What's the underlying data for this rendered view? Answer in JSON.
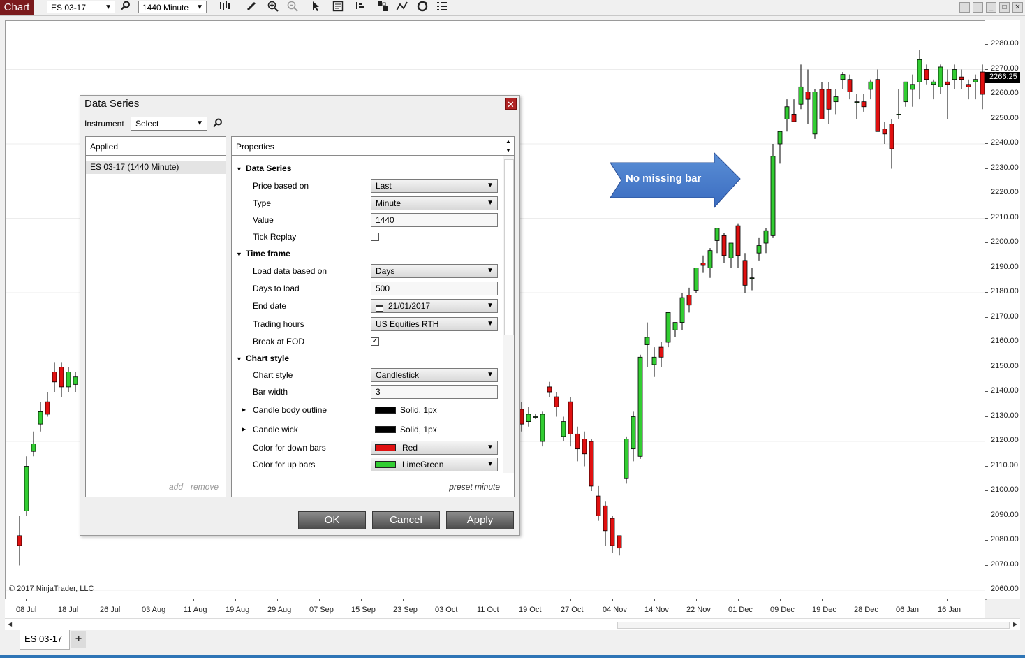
{
  "toolbar": {
    "chart_tab": "Chart",
    "instrument": "ES 03-17",
    "interval": "1440 Minute",
    "icons": [
      "search-icon",
      "bars-icon",
      "pencil-icon",
      "zoom-in-icon",
      "zoom-out-icon",
      "pointer-icon",
      "data-box-icon",
      "indicators-icon",
      "strategies-icon",
      "drawing-tools-icon",
      "refresh-icon",
      "properties-list-icon"
    ]
  },
  "chart": {
    "copyright": "© 2017 NinjaTrader, LLC",
    "price_ticks": [
      "2280.00",
      "2270.00",
      "2260.00",
      "2250.00",
      "2240.00",
      "2230.00",
      "2220.00",
      "2210.00",
      "2200.00",
      "2190.00",
      "2180.00",
      "2170.00",
      "2160.00",
      "2150.00",
      "2140.00",
      "2130.00",
      "2120.00",
      "2110.00",
      "2100.00",
      "2090.00",
      "2080.00",
      "2070.00",
      "2060.00"
    ],
    "last_price": "2266.25",
    "date_ticks": [
      "08 Jul",
      "18 Jul",
      "26 Jul",
      "03 Aug",
      "11 Aug",
      "19 Aug",
      "29 Aug",
      "07 Sep",
      "15 Sep",
      "23 Sep",
      "03 Oct",
      "11 Oct",
      "19 Oct",
      "27 Oct",
      "04 Nov",
      "14 Nov",
      "22 Nov",
      "01 Dec",
      "09 Dec",
      "19 Dec",
      "28 Dec",
      "06 Jan",
      "16 Jan"
    ],
    "annotation": "No missing bar",
    "down_color": "#e01010",
    "up_color": "#32cd32"
  },
  "chart_data": {
    "type": "candlestick",
    "ylim": [
      2060,
      2285
    ],
    "candles_left": [
      {
        "o": 2082,
        "h": 2090,
        "l": 2070,
        "c": 2078
      },
      {
        "o": 2092,
        "h": 2114,
        "l": 2090,
        "c": 2110
      },
      {
        "o": 2116,
        "h": 2124,
        "l": 2114,
        "c": 2119
      },
      {
        "o": 2127,
        "h": 2136,
        "l": 2124,
        "c": 2132
      },
      {
        "o": 2136,
        "h": 2140,
        "l": 2130,
        "c": 2131
      },
      {
        "o": 2148,
        "h": 2152,
        "l": 2140,
        "c": 2144
      },
      {
        "o": 2150,
        "h": 2152,
        "l": 2138,
        "c": 2142
      },
      {
        "o": 2142,
        "h": 2150,
        "l": 2140,
        "c": 2148
      },
      {
        "o": 2143,
        "h": 2148,
        "l": 2140,
        "c": 2146
      }
    ],
    "candles_right": [
      {
        "o": 2133,
        "h": 2136,
        "l": 2124,
        "c": 2127
      },
      {
        "o": 2128,
        "h": 2134,
        "l": 2126,
        "c": 2131
      },
      {
        "o": 2130,
        "h": 2131,
        "l": 2129,
        "c": 2130
      },
      {
        "o": 2120,
        "h": 2132,
        "l": 2118,
        "c": 2131
      },
      {
        "o": 2142,
        "h": 2144,
        "l": 2138,
        "c": 2140
      },
      {
        "o": 2138,
        "h": 2140,
        "l": 2130,
        "c": 2134
      },
      {
        "o": 2122,
        "h": 2130,
        "l": 2120,
        "c": 2128
      },
      {
        "o": 2136,
        "h": 2138,
        "l": 2118,
        "c": 2123
      },
      {
        "o": 2123,
        "h": 2126,
        "l": 2112,
        "c": 2117
      },
      {
        "o": 2121,
        "h": 2124,
        "l": 2110,
        "c": 2115
      },
      {
        "o": 2120,
        "h": 2121,
        "l": 2100,
        "c": 2102
      },
      {
        "o": 2098,
        "h": 2102,
        "l": 2088,
        "c": 2090
      },
      {
        "o": 2094,
        "h": 2096,
        "l": 2078,
        "c": 2084
      },
      {
        "o": 2089,
        "h": 2090,
        "l": 2075,
        "c": 2078
      },
      {
        "o": 2082,
        "h": 2082,
        "l": 2074,
        "c": 2077
      },
      {
        "o": 2105,
        "h": 2122,
        "l": 2103,
        "c": 2121
      },
      {
        "o": 2117,
        "h": 2132,
        "l": 2112,
        "c": 2130
      },
      {
        "o": 2114,
        "h": 2155,
        "l": 2113,
        "c": 2154
      },
      {
        "o": 2159,
        "h": 2168,
        "l": 2150,
        "c": 2162
      },
      {
        "o": 2151,
        "h": 2158,
        "l": 2146,
        "c": 2154
      },
      {
        "o": 2158,
        "h": 2160,
        "l": 2150,
        "c": 2154
      },
      {
        "o": 2160,
        "h": 2172,
        "l": 2158,
        "c": 2172
      },
      {
        "o": 2165,
        "h": 2168,
        "l": 2162,
        "c": 2168
      },
      {
        "o": 2168,
        "h": 2180,
        "l": 2165,
        "c": 2178
      },
      {
        "o": 2179,
        "h": 2182,
        "l": 2172,
        "c": 2175
      },
      {
        "o": 2181,
        "h": 2190,
        "l": 2180,
        "c": 2190
      },
      {
        "o": 2192,
        "h": 2195,
        "l": 2188,
        "c": 2191
      },
      {
        "o": 2190,
        "h": 2198,
        "l": 2186,
        "c": 2197
      },
      {
        "o": 2201,
        "h": 2206,
        "l": 2196,
        "c": 2206
      },
      {
        "o": 2203,
        "h": 2204,
        "l": 2192,
        "c": 2195
      },
      {
        "o": 2194,
        "h": 2200,
        "l": 2190,
        "c": 2200
      },
      {
        "o": 2207,
        "h": 2208,
        "l": 2190,
        "c": 2195
      },
      {
        "o": 2193,
        "h": 2196,
        "l": 2180,
        "c": 2183
      },
      {
        "o": 2186,
        "h": 2190,
        "l": 2181,
        "c": 2186
      },
      {
        "o": 2196,
        "h": 2202,
        "l": 2193,
        "c": 2199
      },
      {
        "o": 2200,
        "h": 2206,
        "l": 2196,
        "c": 2205
      },
      {
        "o": 2203,
        "h": 2240,
        "l": 2202,
        "c": 2235
      },
      {
        "o": 2240,
        "h": 2244,
        "l": 2232,
        "c": 2245
      },
      {
        "o": 2250,
        "h": 2258,
        "l": 2245,
        "c": 2255
      },
      {
        "o": 2252,
        "h": 2258,
        "l": 2250,
        "c": 2249
      },
      {
        "o": 2256,
        "h": 2272,
        "l": 2254,
        "c": 2263
      },
      {
        "o": 2261,
        "h": 2270,
        "l": 2248,
        "c": 2258
      },
      {
        "o": 2244,
        "h": 2262,
        "l": 2242,
        "c": 2261
      },
      {
        "o": 2262,
        "h": 2265,
        "l": 2250,
        "c": 2250
      },
      {
        "o": 2262,
        "h": 2265,
        "l": 2248,
        "c": 2254
      },
      {
        "o": 2257,
        "h": 2262,
        "l": 2252,
        "c": 2259
      },
      {
        "o": 2266,
        "h": 2269,
        "l": 2262,
        "c": 2268
      },
      {
        "o": 2266,
        "h": 2268,
        "l": 2258,
        "c": 2261
      },
      {
        "o": 2257,
        "h": 2260,
        "l": 2250,
        "c": 2257
      },
      {
        "o": 2257,
        "h": 2260,
        "l": 2253,
        "c": 2255
      },
      {
        "o": 2262,
        "h": 2266,
        "l": 2258,
        "c": 2265
      },
      {
        "o": 2266,
        "h": 2270,
        "l": 2245,
        "c": 2245
      },
      {
        "o": 2246,
        "h": 2249,
        "l": 2240,
        "c": 2244
      },
      {
        "o": 2248,
        "h": 2250,
        "l": 2230,
        "c": 2238
      },
      {
        "o": 2252,
        "h": 2262,
        "l": 2250,
        "c": 2252
      },
      {
        "o": 2257,
        "h": 2265,
        "l": 2255,
        "c": 2265
      },
      {
        "o": 2262,
        "h": 2268,
        "l": 2255,
        "c": 2264
      },
      {
        "o": 2265,
        "h": 2278,
        "l": 2258,
        "c": 2274
      },
      {
        "o": 2270,
        "h": 2272,
        "l": 2264,
        "c": 2266
      },
      {
        "o": 2264,
        "h": 2266,
        "l": 2258,
        "c": 2265
      },
      {
        "o": 2263,
        "h": 2272,
        "l": 2260,
        "c": 2271
      },
      {
        "o": 2265,
        "h": 2270,
        "l": 2250,
        "c": 2264
      },
      {
        "o": 2266,
        "h": 2272,
        "l": 2262,
        "c": 2270
      },
      {
        "o": 2267,
        "h": 2270,
        "l": 2262,
        "c": 2266
      },
      {
        "o": 2264,
        "h": 2266,
        "l": 2258,
        "c": 2263
      },
      {
        "o": 2265,
        "h": 2268,
        "l": 2258,
        "c": 2266
      },
      {
        "o": 2269,
        "h": 2272,
        "l": 2254,
        "c": 2260
      },
      {
        "o": 2264,
        "h": 2272,
        "l": 2260,
        "c": 2266
      }
    ]
  },
  "dialog": {
    "title": "Data Series",
    "instrument_label": "Instrument",
    "instrument_value": "Select",
    "applied_header": "Applied",
    "applied_item": "ES 03-17 (1440 Minute)",
    "add": "add",
    "remove": "remove",
    "properties_header": "Properties",
    "sections": {
      "data_series": "Data Series",
      "time_frame": "Time frame",
      "chart_style": "Chart style"
    },
    "labels": {
      "price_based_on": "Price based on",
      "type": "Type",
      "value": "Value",
      "tick_replay": "Tick Replay",
      "load_data_based_on": "Load data based on",
      "days_to_load": "Days to load",
      "end_date": "End date",
      "trading_hours": "Trading hours",
      "break_at_eod": "Break at EOD",
      "chart_style": "Chart style",
      "bar_width": "Bar width",
      "candle_body_outline": "Candle body outline",
      "candle_wick": "Candle wick",
      "color_down": "Color for down bars",
      "color_up": "Color for up bars"
    },
    "values": {
      "price_based_on": "Last",
      "type": "Minute",
      "value": "1440",
      "load_data_based_on": "Days",
      "days_to_load": "500",
      "end_date": "21/01/2017",
      "trading_hours": "US Equities RTH",
      "chart_style": "Candlestick",
      "bar_width": "3",
      "candle_body_outline": "Solid, 1px",
      "candle_wick": "Solid, 1px",
      "color_down": "Red",
      "color_up": "LimeGreen"
    },
    "tick_replay_checked": false,
    "break_at_eod_checked": true,
    "preset": "preset minute",
    "ok": "OK",
    "cancel": "Cancel",
    "apply": "Apply"
  },
  "tabs": {
    "tab1": "ES 03-17",
    "add": "+"
  }
}
